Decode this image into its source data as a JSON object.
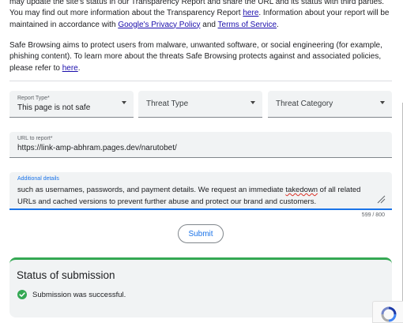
{
  "intro": {
    "p1_a": "may update the site's status in our Transparency Report and share the URL and its status with third parties. You may find out more information about the Transparency Report ",
    "p1_link1": "here",
    "p1_b": ". Information about your report will be maintained in accordance with ",
    "p1_link2": "Google's Privacy Policy",
    "p1_c": " and ",
    "p1_link3": "Terms of Service",
    "p1_d": ".",
    "p2_a": "Safe Browsing aims to protect users from malware, unwanted software, or social engineering (for example, phishing content). To learn more about the threats Safe Browsing protects against and associated policies, please refer to ",
    "p2_link": "here",
    "p2_b": "."
  },
  "form": {
    "report_type": {
      "label": "Report Type*",
      "value": "This page is not safe"
    },
    "threat_type": {
      "placeholder": "Threat Type"
    },
    "threat_category": {
      "placeholder": "Threat Category"
    },
    "url": {
      "label": "URL to report*",
      "value": "https://link-amp-abhram.pages.dev/narutobet/"
    },
    "details": {
      "label": "Additional details",
      "value_a": "such as usernames, passwords, and payment details. We request an immediate ",
      "value_misspelled": "takedown",
      "value_b": " of all related URLs and cached versions to prevent further abuse and protect our brand and customers."
    },
    "counter": "599 / 800",
    "submit_label": "Submit"
  },
  "status": {
    "title": "Status of submission",
    "message": "Submission was successful."
  },
  "colors": {
    "link": "#1a0dab",
    "accent": "#1a73e8",
    "success": "#34a853",
    "field_bg": "#f1f3f4"
  },
  "icons": [
    "chevron-down-icon",
    "check-circle-icon",
    "resize-handle-icon",
    "recaptcha-icon"
  ]
}
